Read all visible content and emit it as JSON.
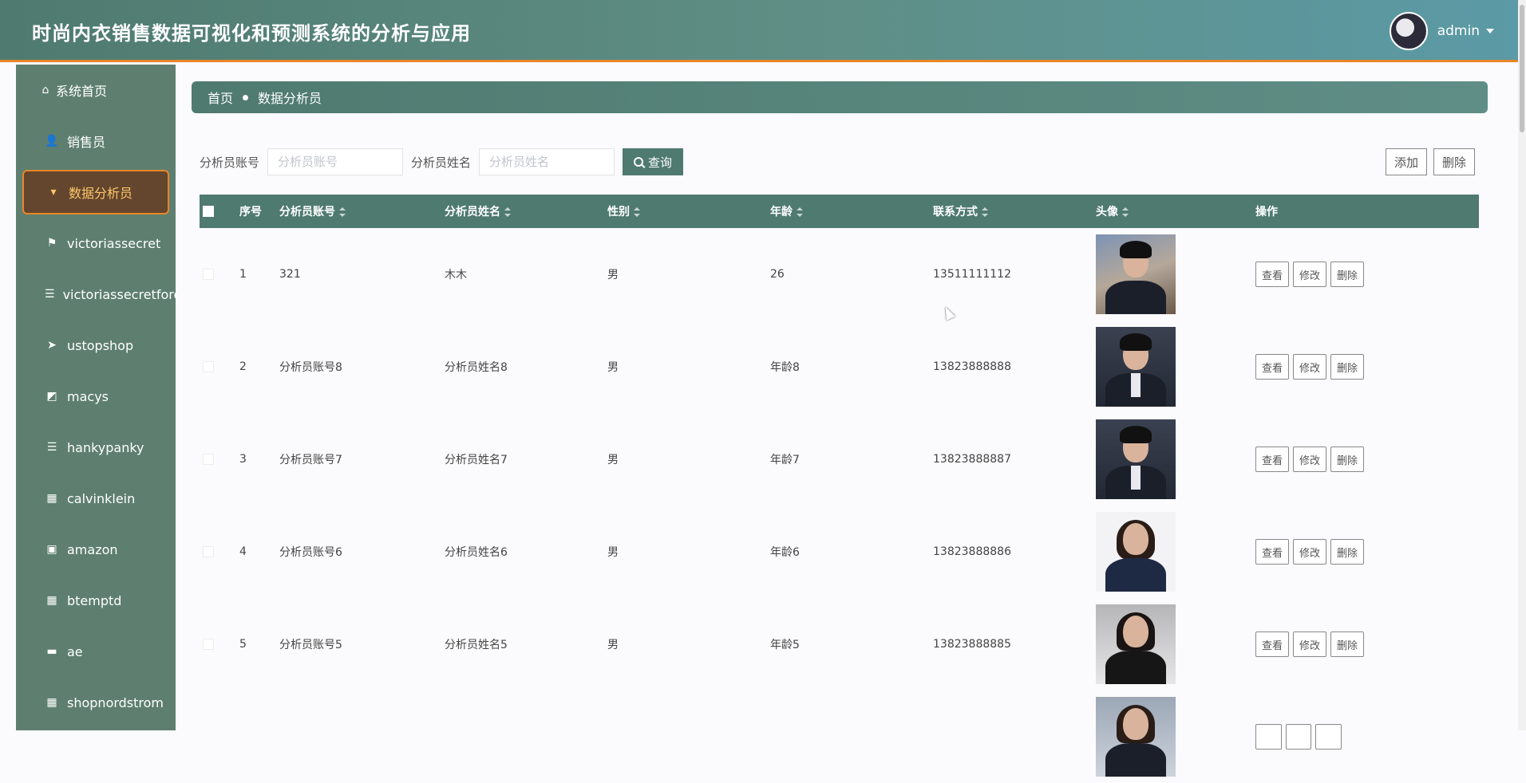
{
  "app": {
    "title": "时尚内衣销售数据可视化和预测系统的分析与应用",
    "user": {
      "name": "admin"
    }
  },
  "sidebar": {
    "items": [
      {
        "label": "系统首页",
        "icon": "home-icon"
      },
      {
        "label": "销售员",
        "icon": "user-icon"
      },
      {
        "label": "数据分析员",
        "icon": "analyst-icon",
        "active": true
      },
      {
        "label": "victoriassecret",
        "icon": "flag-icon"
      },
      {
        "label": "victoriassecretforec",
        "icon": "list-icon"
      },
      {
        "label": "ustopshop",
        "icon": "send-icon"
      },
      {
        "label": "macys",
        "icon": "chart-icon"
      },
      {
        "label": "hankypanky",
        "icon": "list-icon"
      },
      {
        "label": "calvinklein",
        "icon": "grid-icon"
      },
      {
        "label": "amazon",
        "icon": "box-icon"
      },
      {
        "label": "btemptd",
        "icon": "grid-icon"
      },
      {
        "label": "ae",
        "icon": "ticket-icon"
      },
      {
        "label": "shopnordstrom",
        "icon": "grid-icon"
      }
    ]
  },
  "breadcrumb": {
    "home": "首页",
    "current": "数据分析员"
  },
  "search": {
    "account_label": "分析员账号",
    "account_placeholder": "分析员账号",
    "name_label": "分析员姓名",
    "name_placeholder": "分析员姓名",
    "query_label": "查询"
  },
  "actions": {
    "add": "添加",
    "delete": "删除"
  },
  "table": {
    "headers": {
      "no": "序号",
      "account": "分析员账号",
      "name": "分析员姓名",
      "sex": "性别",
      "age": "年龄",
      "tel": "联系方式",
      "avatar": "头像",
      "ops": "操作"
    },
    "op_labels": {
      "view": "查看",
      "edit": "修改",
      "delete": "删除"
    },
    "rows": [
      {
        "no": "1",
        "account": "321",
        "name": "木木",
        "sex": "男",
        "age": "26",
        "tel": "13511111112"
      },
      {
        "no": "2",
        "account": "分析员账号8",
        "name": "分析员姓名8",
        "sex": "男",
        "age": "年龄8",
        "tel": "13823888888"
      },
      {
        "no": "3",
        "account": "分析员账号7",
        "name": "分析员姓名7",
        "sex": "男",
        "age": "年龄7",
        "tel": "13823888887"
      },
      {
        "no": "4",
        "account": "分析员账号6",
        "name": "分析员姓名6",
        "sex": "男",
        "age": "年龄6",
        "tel": "13823888886"
      },
      {
        "no": "5",
        "account": "分析员账号5",
        "name": "分析员姓名5",
        "sex": "男",
        "age": "年龄5",
        "tel": "13823888885"
      }
    ]
  },
  "colors": {
    "primary": "#4f7a70",
    "accent": "#e88628",
    "sidebar": "#5e7f6f"
  }
}
